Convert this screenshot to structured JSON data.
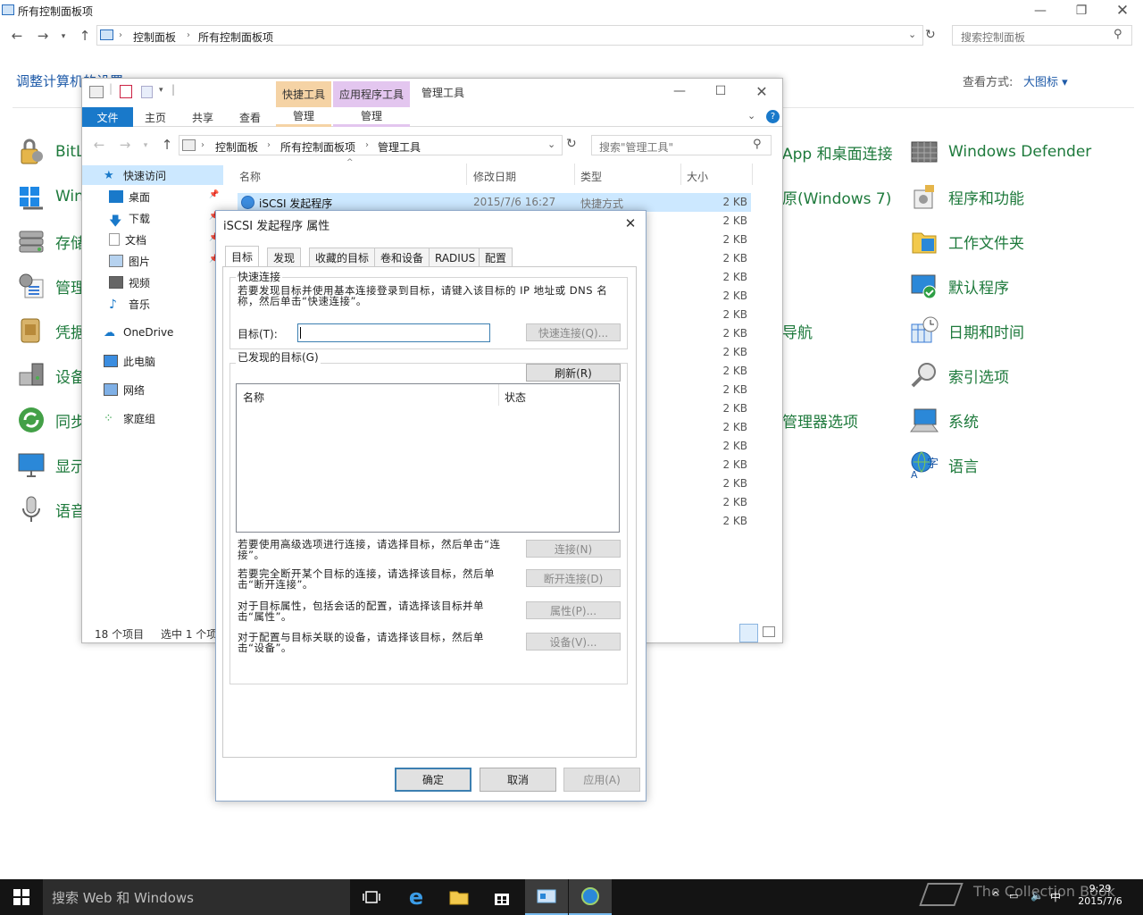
{
  "control_panel": {
    "window_title": "所有控制面板项",
    "breadcrumb": [
      "控制面板",
      "所有控制面板项"
    ],
    "search_placeholder": "搜索控制面板",
    "heading": "调整计算机的设置",
    "view_by_label": "查看方式:",
    "view_by_value": "大图标 ▾",
    "left_items": [
      {
        "label": "BitL",
        "icon": "bitlocker-icon"
      },
      {
        "label": "Win",
        "icon": "windows-update-icon"
      },
      {
        "label": "存储",
        "icon": "storage-icon"
      },
      {
        "label": "管理",
        "icon": "admin-tools-icon"
      },
      {
        "label": "凭据",
        "icon": "credential-icon"
      },
      {
        "label": "设备",
        "icon": "devices-icon"
      },
      {
        "label": "同步",
        "icon": "sync-icon"
      },
      {
        "label": "显示",
        "icon": "display-icon"
      },
      {
        "label": "语音",
        "icon": "microphone-icon"
      }
    ],
    "middle_items": [
      {
        "label": "App 和桌面连接",
        "icon": "remoteapp-icon"
      },
      {
        "label": "原(Windows 7)",
        "icon": "backup-icon"
      },
      {
        "label": "导航",
        "icon": "nav-icon"
      },
      {
        "label": "管理器选项",
        "icon": "manager-icon"
      }
    ],
    "right_items": [
      {
        "label": "Windows Defender",
        "icon": "defender-icon"
      },
      {
        "label": "程序和功能",
        "icon": "programs-icon"
      },
      {
        "label": "工作文件夹",
        "icon": "work-folders-icon"
      },
      {
        "label": "默认程序",
        "icon": "default-programs-icon"
      },
      {
        "label": "日期和时间",
        "icon": "date-time-icon"
      },
      {
        "label": "索引选项",
        "icon": "indexing-icon"
      },
      {
        "label": "系统",
        "icon": "system-icon"
      },
      {
        "label": "语言",
        "icon": "language-icon"
      }
    ]
  },
  "explorer": {
    "title": "管理工具",
    "context_tabs": [
      {
        "header": "快捷工具",
        "tab": "管理",
        "color": "#f5d3a5"
      },
      {
        "header": "应用程序工具",
        "tab": "管理",
        "color": "#e3c6ef"
      }
    ],
    "ribbon_tabs": [
      "文件",
      "主页",
      "共享",
      "查看"
    ],
    "breadcrumb": [
      "控制面板",
      "所有控制面板项",
      "管理工具"
    ],
    "search_placeholder": "搜索\"管理工具\"",
    "nav_items": [
      {
        "label": "快速访问",
        "icon": "star-icon"
      },
      {
        "label": "桌面",
        "icon": "desktop-icon"
      },
      {
        "label": "下载",
        "icon": "download-icon"
      },
      {
        "label": "文档",
        "icon": "documents-icon"
      },
      {
        "label": "图片",
        "icon": "pictures-icon"
      },
      {
        "label": "视频",
        "icon": "videos-icon"
      },
      {
        "label": "音乐",
        "icon": "music-icon"
      },
      {
        "label": "OneDrive",
        "icon": "onedrive-icon"
      },
      {
        "label": "此电脑",
        "icon": "this-pc-icon"
      },
      {
        "label": "网络",
        "icon": "network-icon"
      },
      {
        "label": "家庭组",
        "icon": "homegroup-icon"
      }
    ],
    "columns": [
      "名称",
      "修改日期",
      "类型",
      "大小"
    ],
    "first_row": {
      "name": "iSCSI 发起程序",
      "date": "2015/7/6 16:27",
      "type": "快捷方式",
      "size": "2 KB"
    },
    "sizes": [
      "2 KB",
      "2 KB",
      "2 KB",
      "2 KB",
      "2 KB",
      "2 KB",
      "2 KB",
      "2 KB",
      "2 KB",
      "2 KB",
      "2 KB",
      "2 KB",
      "2 KB",
      "2 KB",
      "2 KB",
      "2 KB",
      "2 KB",
      "2 KB"
    ],
    "status_count": "18 个项目",
    "status_selected": "选中 1 个项"
  },
  "dialog": {
    "title": "iSCSI 发起程序 属性",
    "close_glyph": "✕",
    "tabs": [
      "目标",
      "发现",
      "收藏的目标",
      "卷和设备",
      "RADIUS",
      "配置"
    ],
    "quick_connect": {
      "group_label": "快速连接",
      "desc": "若要发现目标并使用基本连接登录到目标，请键入该目标的 IP 地址或 DNS 名称，然后单击“快速连接”。",
      "target_label": "目标(T):",
      "target_value": "",
      "button": "快速连接(Q)..."
    },
    "discovered": {
      "group_label": "已发现的目标(G)",
      "refresh": "刷新(R)",
      "columns": [
        "名称",
        "状态"
      ]
    },
    "actions": [
      {
        "desc": "若要使用高级选项进行连接，请选择目标，然后单击“连接”。",
        "button": "连接(N)"
      },
      {
        "desc": "若要完全断开某个目标的连接，请选择该目标，然后单击“断开连接”。",
        "button": "断开连接(D)"
      },
      {
        "desc": "对于目标属性，包括会话的配置，请选择该目标并单击“属性”。",
        "button": "属性(P)..."
      },
      {
        "desc": "对于配置与目标关联的设备，请选择该目标，然后单击“设备”。",
        "button": "设备(V)..."
      }
    ],
    "ok": "确定",
    "cancel": "取消",
    "apply": "应用(A)"
  },
  "taskbar": {
    "search_placeholder": "搜索 Web 和 Windows",
    "watermark": "The Collection Book",
    "time": "9:29",
    "date": "2015/7/6",
    "ime": "中",
    "accent": "#76b9ed"
  }
}
